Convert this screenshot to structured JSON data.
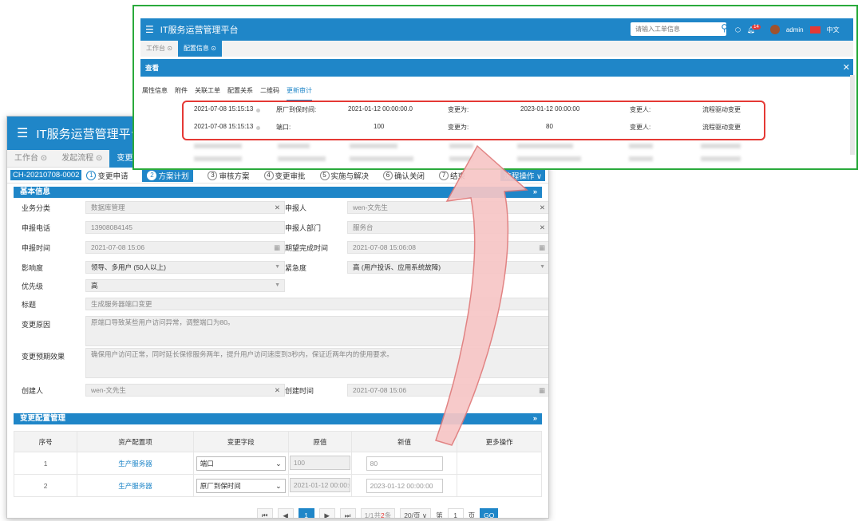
{
  "back": {
    "app_title": "IT服务运营管理平台",
    "tabs": [
      "工作台 ⊙",
      "发起流程 ⊙",
      "变更管理"
    ],
    "ticket_code": "CH-20210708-0002",
    "steps": [
      {
        "num": "1",
        "label": "变更申请"
      },
      {
        "num": "2",
        "label": "方案计划"
      },
      {
        "num": "3",
        "label": "审核方案"
      },
      {
        "num": "4",
        "label": "变更审批"
      },
      {
        "num": "5",
        "label": "实施与解决"
      },
      {
        "num": "6",
        "label": "确认关闭"
      },
      {
        "num": "7",
        "label": "结束"
      }
    ],
    "flow_op": "流程操作 ∨",
    "basic_info": {
      "title": "基本信息",
      "labels": {
        "category": "业务分类",
        "requester": "申报人",
        "phone": "申报电话",
        "dept": "申报人部门",
        "report_time": "申报时间",
        "expected_time": "期望完成时间",
        "impact": "影响度",
        "urgency": "紧急度",
        "priority": "优先级",
        "subject": "标题",
        "reason": "变更原因",
        "effect": "变更预期效果",
        "creator": "创建人",
        "created_time": "创建时间"
      },
      "values": {
        "category": "数据库管理",
        "requester": "wen-文先生",
        "phone": "13908084145",
        "dept": "服务台",
        "report_time": "2021-07-08 15:06",
        "expected_time": "2021-07-08 15:06:08",
        "impact": "领导、多用户 (50人以上)",
        "urgency": "高 (用户投诉、应用系统故障)",
        "priority": "高",
        "subject": "生成服务器端口变更",
        "reason": "原端口导致某些用户访问异常，调整端口为80。",
        "effect": "确保用户访问正常，同时延长保修服务两年，提升用户访问速度到3秒内，保证近两年内的使用要求。",
        "creator": "wen-文先生",
        "created_time": "2021-07-08 15:06"
      }
    },
    "config": {
      "title": "变更配置管理",
      "headers": [
        "序号",
        "资产配置项",
        "变更字段",
        "原值",
        "新值",
        "更多操作"
      ],
      "rows": [
        {
          "no": "1",
          "asset": "生产服务器",
          "field": "端口",
          "orig": "100",
          "new": "80"
        },
        {
          "no": "2",
          "asset": "生产服务器",
          "field": "原厂到保时间",
          "orig": "2021-01-12 00:00:00",
          "new": "2023-01-12 00:00:00"
        }
      ]
    },
    "pager": {
      "first": "⏮",
      "prev": "◀",
      "page": "1",
      "next": "▶",
      "last": "⏭",
      "info_pre": "1/1共",
      "info_count": "2",
      "info_post": "条",
      "size": "20/页 ∨",
      "goto_pre": "第",
      "goto_val": "1",
      "goto_post": "页",
      "go": "GO"
    }
  },
  "front": {
    "app_title": "IT服务运营管理平台",
    "search_placeholder": "请输入工单信息",
    "badge": "14",
    "user": "admin",
    "lang": "中文",
    "tabs": [
      "工作台 ⊙",
      "配置信息 ⊙"
    ],
    "view_title": "查看",
    "subtabs": [
      "属性信息",
      "附件",
      "关联工单",
      "配置关系",
      "二维码",
      "更新审计"
    ],
    "audit": [
      {
        "time": "2021-07-08 15:15:13",
        "field": "原厂到保时间:",
        "old": "2021-01-12 00:00:00.0",
        "to": "变更为:",
        "new": "2023-01-12 00:00:00",
        "who_label": "变更人:",
        "who": "流程驱动变更"
      },
      {
        "time": "2021-07-08 15:15:13",
        "field": "端口:",
        "old": "100",
        "to": "变更为:",
        "new": "80",
        "who_label": "变更人:",
        "who": "流程驱动变更"
      }
    ]
  },
  "colors": {
    "primary": "#1f86c8",
    "highlight_green": "#2aaa3c",
    "highlight_red": "#e53935",
    "arrow_fill": "#f7c6c6"
  }
}
